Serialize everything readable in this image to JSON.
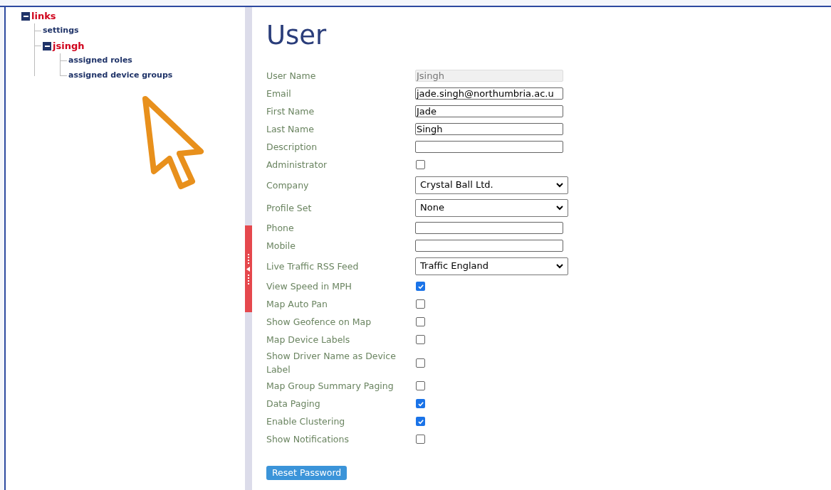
{
  "tree": [
    {
      "label": "links",
      "expanded": true,
      "children": [
        {
          "label": "settings"
        },
        {
          "label": "jsingh",
          "expanded": true,
          "children": [
            {
              "label": "assigned roles"
            },
            {
              "label": "assigned device groups"
            }
          ]
        }
      ]
    }
  ],
  "form": {
    "title": "User",
    "fields": [
      {
        "kind": "text",
        "label": "User Name",
        "value": "Jsingh",
        "disabled": true
      },
      {
        "kind": "text",
        "label": "Email",
        "value": "jade.singh@northumbria.ac.u",
        "disabled": false
      },
      {
        "kind": "text",
        "label": "First Name",
        "value": "Jade",
        "disabled": false
      },
      {
        "kind": "text",
        "label": "Last Name",
        "value": "Singh",
        "disabled": false
      },
      {
        "kind": "text",
        "label": "Description",
        "disabled": false
      },
      {
        "kind": "checkbox",
        "label": "Administrator",
        "checked": false
      },
      {
        "kind": "select",
        "label": "Company",
        "value": "Crystal Ball Ltd."
      },
      {
        "kind": "select",
        "label": "Profile Set",
        "value": "None"
      },
      {
        "kind": "text",
        "label": "Phone",
        "disabled": false
      },
      {
        "kind": "text",
        "label": "Mobile",
        "disabled": false
      },
      {
        "kind": "select",
        "label": "Live Traffic RSS Feed",
        "value": "Traffic England"
      },
      {
        "kind": "checkbox",
        "label": "View Speed in MPH",
        "checked": true
      },
      {
        "kind": "checkbox",
        "label": "Map Auto Pan",
        "checked": false
      },
      {
        "kind": "checkbox",
        "label": "Show Geofence on Map",
        "checked": false
      },
      {
        "kind": "checkbox",
        "label": "Map Device Labels",
        "checked": false
      },
      {
        "kind": "checkbox",
        "label": "Show Driver Name as Device Label",
        "checked": false
      },
      {
        "kind": "checkbox",
        "label": "Map Group Summary Paging",
        "checked": false
      },
      {
        "kind": "checkbox",
        "label": "Data Paging",
        "checked": true
      },
      {
        "kind": "checkbox",
        "label": "Enable Clustering",
        "checked": true
      },
      {
        "kind": "checkbox",
        "label": "Show Notifications",
        "checked": false
      }
    ],
    "button": "Reset Password"
  }
}
